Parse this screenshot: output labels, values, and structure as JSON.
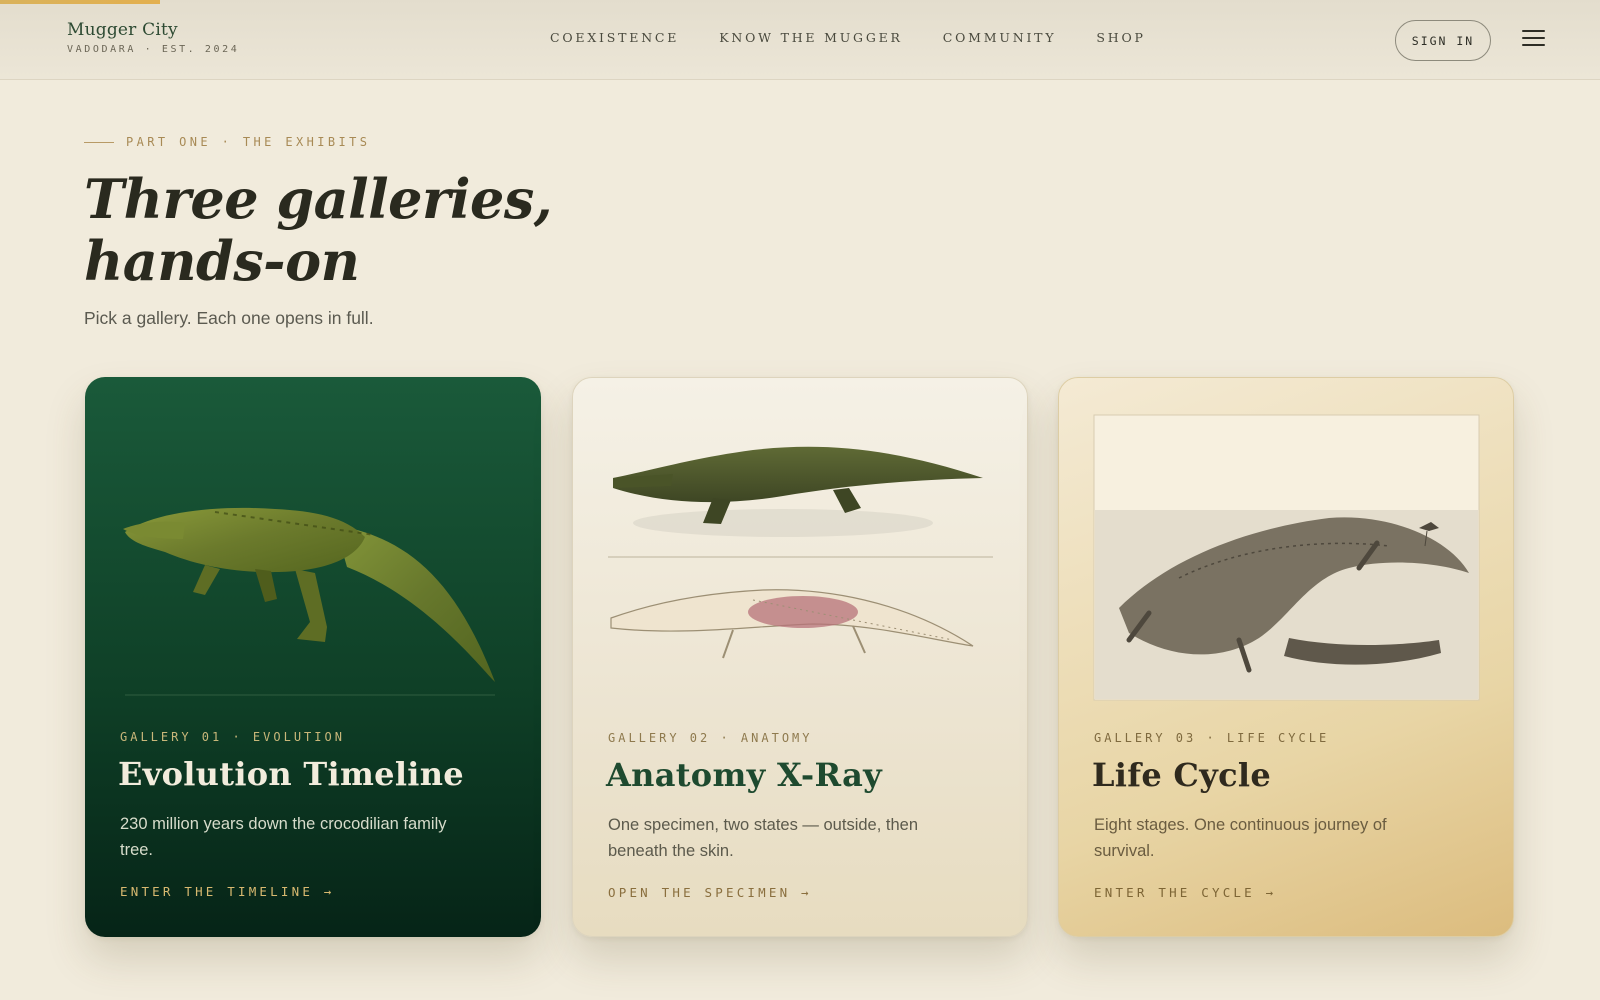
{
  "page": {
    "scroll_progress": 0.1
  },
  "header": {
    "brand_name": "Mugger City",
    "brand_sub": "VADODARA · EST. 2024",
    "nav": [
      {
        "label": "COEXISTENCE"
      },
      {
        "label": "KNOW THE MUGGER"
      },
      {
        "label": "COMMUNITY"
      },
      {
        "label": "SHOP"
      }
    ],
    "sign_in_label": "SIGN IN",
    "menu_icon": "hamburger-icon"
  },
  "intro": {
    "eyebrow": "PART ONE · THE EXHIBITS",
    "headline": "Three galleries, hands-on",
    "subline": "Pick a gallery. Each one opens in full."
  },
  "galleries": [
    {
      "meta": "GALLERY 01 · EVOLUTION",
      "title": "Evolution Timeline",
      "description": "230 million years down the crocodilian family tree.",
      "cta": "ENTER THE TIMELINE →",
      "art": "ancient-crocodilian-illustration"
    },
    {
      "meta": "GALLERY 02 · ANATOMY",
      "title": "Anatomy X-Ray",
      "description": "One specimen, two states — outside, then beneath the skin.",
      "cta": "OPEN THE SPECIMEN →",
      "art": "crocodile-and-skeleton-illustration"
    },
    {
      "meta": "GALLERY 03 · LIFE CYCLE",
      "title": "Life Cycle",
      "description": "Eight stages. One continuous journey of survival.",
      "cta": "ENTER THE CYCLE →",
      "art": "crocodile-engraving-illustration"
    }
  ],
  "colors": {
    "background": "#f1ebdc",
    "accent_gold": "#d9b25c",
    "forest_green": "#0f4027"
  }
}
